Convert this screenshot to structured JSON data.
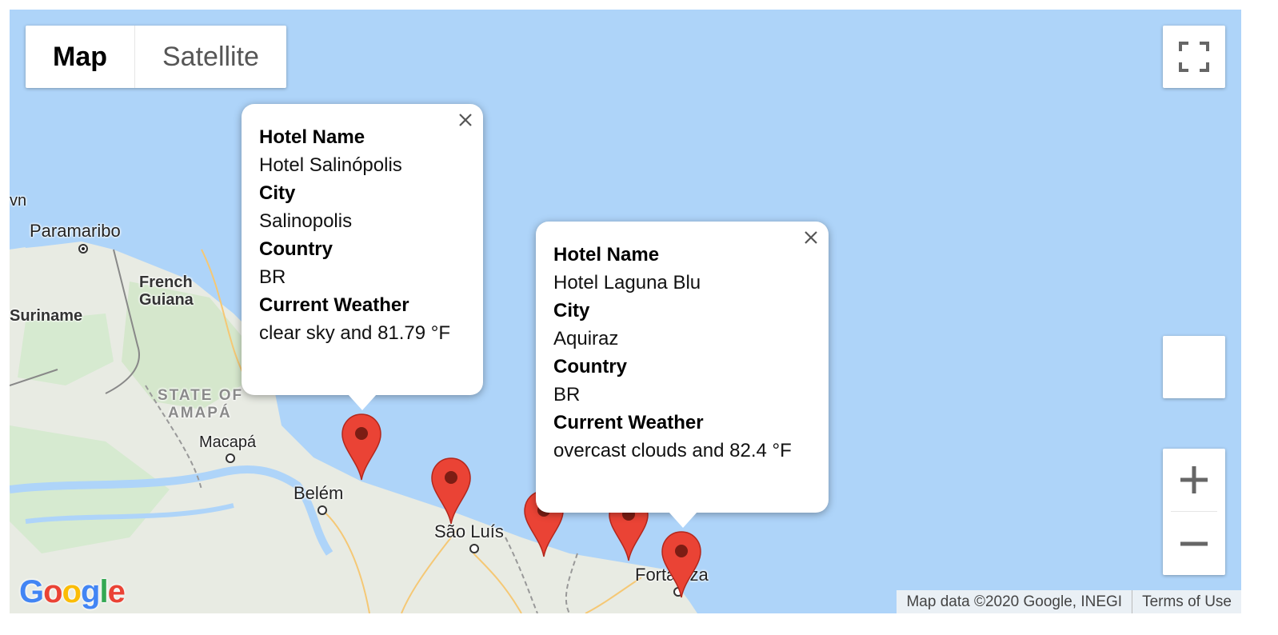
{
  "map_type": {
    "map_label": "Map",
    "satellite_label": "Satellite",
    "selected": "Map"
  },
  "controls": {
    "fullscreen_icon": "fullscreen-icon",
    "pegman_icon": "pegman-icon",
    "zoom_in_icon": "plus-icon",
    "zoom_out_icon": "minus-icon"
  },
  "places": {
    "cut": "vn",
    "paramaribo": "Paramaribo",
    "french_guiana_1": "French",
    "french_guiana_2": "Guiana",
    "suriname": "Suriname",
    "state_amapa_1": "STATE OF",
    "state_amapa_2": "AMAPÁ",
    "macapa": "Macapá",
    "belem": "Belém",
    "sao_luis": "São Luís",
    "fortaleza": "Fortaleza"
  },
  "info_windows": [
    {
      "hotel_name_label": "Hotel Name",
      "hotel_name": "Hotel Salinópolis",
      "city_label": "City",
      "city": "Salinopolis",
      "country_label": "Country",
      "country": "BR",
      "weather_label": "Current Weather",
      "weather": "clear sky and 81.79 °F"
    },
    {
      "hotel_name_label": "Hotel Name",
      "hotel_name": "Hotel Laguna Blu",
      "city_label": "City",
      "city": "Aquiraz",
      "country_label": "Country",
      "country": "BR",
      "weather_label": "Current Weather",
      "weather": "overcast clouds and 82.4 °F"
    }
  ],
  "markers_count_note": "5 red markers",
  "colors": {
    "water": "#aed4f9",
    "land": "#e8ebe3",
    "forest": "#cfe6c6",
    "marker": "#ea4335",
    "marker_dot": "#7c1d14"
  },
  "google_logo": "Google",
  "attribution": {
    "map_data": "Map data ©2020 Google, INEGI",
    "terms": "Terms of Use"
  }
}
